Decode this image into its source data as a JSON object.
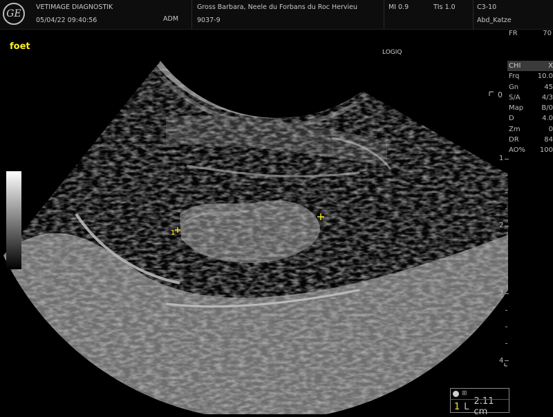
{
  "header": {
    "logo": "GE",
    "clinic": "VETIMAGE DIAGNOSTIK",
    "datetime": "05/04/22 09:40:56",
    "operator": "ADM",
    "patient": "Gross Barbara, Neele du Forbans du Roc Hervieu",
    "patient_id": "9037-9",
    "mi": "MI 0.9",
    "tis": "TIs 1.0",
    "probe": "C3-10",
    "preset": "Abd_Katze"
  },
  "image": {
    "annotation": "foet",
    "brand": "LOGIQ",
    "caliper_number": "1",
    "orientation_marker": "0"
  },
  "params": {
    "fr_label": "FR",
    "fr_value": "70",
    "header_label": "CHI",
    "header_value": "X",
    "rows": [
      {
        "label": "Frq",
        "value": "10.0"
      },
      {
        "label": "Gn",
        "value": "45"
      },
      {
        "label": "S/A",
        "value": "4/3"
      },
      {
        "label": "Map",
        "value": "B/0"
      },
      {
        "label": "D",
        "value": "4.0"
      },
      {
        "label": "Zm",
        "value": "0"
      },
      {
        "label": "DR",
        "value": "84"
      },
      {
        "label": "AO%",
        "value": "100"
      }
    ]
  },
  "depth_scale": {
    "marks": [
      "1",
      "2",
      "3",
      "4"
    ]
  },
  "measurement": {
    "index": "1",
    "type": "L",
    "value": "2.11 cm"
  },
  "colors": {
    "caliper": "#ffee22",
    "annotation": "#ffee22",
    "panel_header": "#3a3a3a"
  }
}
